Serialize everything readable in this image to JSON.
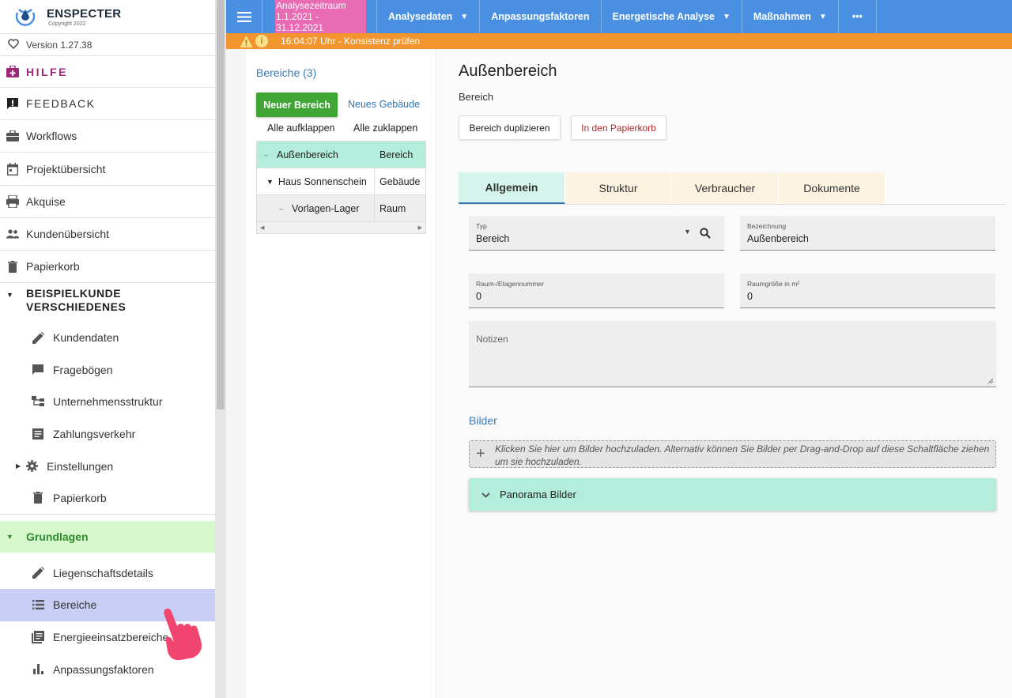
{
  "sidebar": {
    "brand": {
      "name": "ENSPECTER",
      "copyright": "Copyright 2022"
    },
    "version": "Version 1.27.38",
    "hilfe": "HILFE",
    "feedback": "FEEDBACK",
    "nav": [
      "Workflows",
      "Projektübersicht",
      "Akquise",
      "Kundenübersicht",
      "Papierkorb"
    ],
    "customer_group": {
      "line1": "BEISPIELKUNDE",
      "line2": "VERSCHIEDENES"
    },
    "customer_items": [
      "Kundendaten",
      "Fragebögen",
      "Unternehmensstruktur",
      "Zahlungsverkehr",
      "Einstellungen",
      "Papierkorb"
    ],
    "grundlagen": "Grundlagen",
    "grundlagen_items": [
      "Liegenschaftsdetails",
      "Bereiche",
      "Energieeinsatzbereiche",
      "Anpassungsfaktoren"
    ]
  },
  "topbar": {
    "period_label": "Analysezeitraum",
    "period_range": "1.1.2021 - 31.12.2021",
    "items": [
      "Analysedaten",
      "Anpassungsfaktoren",
      "Energetische Analyse",
      "Maßnahmen"
    ],
    "more": "•••"
  },
  "status": {
    "text": "16:04:07 Uhr - Konsistenz prüfen"
  },
  "tree": {
    "title": "Bereiche (3)",
    "new_button": "Neuer Bereich",
    "new_building_link": "Neues Gebäude",
    "expand_all": "Alle aufklappen",
    "collapse_all": "Alle zuklappen",
    "rows": [
      {
        "name": "Außenbereich",
        "type": "Bereich"
      },
      {
        "name": "Haus Sonnenschein",
        "type": "Gebäude"
      },
      {
        "name": "Vorlagen-Lager",
        "type": "Raum"
      }
    ]
  },
  "main": {
    "title": "Außenbereich",
    "subtitle": "Bereich",
    "duplicate_button": "Bereich duplizieren",
    "trash_button": "In den Papierkorb",
    "tabs": [
      "Allgemein",
      "Struktur",
      "Verbraucher",
      "Dokumente"
    ],
    "fields": {
      "typ": {
        "label": "Typ",
        "value": "Bereich"
      },
      "bezeichnung": {
        "label": "Bezeichnung",
        "value": "Außenbereich"
      },
      "raum": {
        "label": "Raum-/Etagennummer",
        "value": "0"
      },
      "raumgroesse": {
        "label": "Raumgröße in m²",
        "value": "0"
      },
      "notizen": {
        "label": "Notizen",
        "value": ""
      }
    },
    "bilder": "Bilder",
    "upload_text": "Klicken Sie hier um Bilder hochzuladen. Alternativ können Sie Bilder per Drag-and-Drop auf diese Schaltfläche ziehen um sie hochzuladen.",
    "panorama": "Panorama Bilder"
  },
  "colors": {
    "topbar": "#4a90e2",
    "status": "#f2952f",
    "period_highlight": "#e86bb3",
    "accent_green": "#3fa535",
    "selected_row": "#b3eddb"
  }
}
